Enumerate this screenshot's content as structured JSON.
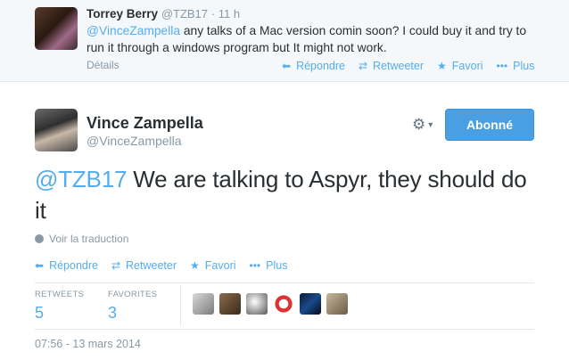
{
  "reply": {
    "name": "Torrey Berry",
    "handle": "@TZB17",
    "time": "· 11 h",
    "mention": "@VinceZampella",
    "text": " any talks of a Mac version comin soon? I could buy it and try to run it through a windows program but It might not work.",
    "details": "Détails",
    "actions": {
      "reply": "Répondre",
      "retweet": "Retweeter",
      "favorite": "Favori",
      "more": "Plus"
    }
  },
  "tweet": {
    "name": "Vince Zampella",
    "handle": "@VinceZampella",
    "follow_label": "Abonné",
    "mention": "@TZB17",
    "text": " We are talking to Aspyr, they should do it",
    "translate": "Voir la traduction",
    "actions": {
      "reply": "Répondre",
      "retweet": "Retweeter",
      "favorite": "Favori",
      "more": "Plus"
    },
    "stats": {
      "retweets_label": "RETWEETS",
      "retweets": "5",
      "favorites_label": "FAVORITES",
      "favorites": "3"
    },
    "timestamp": "07:56 - 13 mars 2014"
  },
  "icons": {
    "reply": "reply-icon",
    "retweet": "retweet-icon",
    "favorite": "star-icon",
    "more": "more-dots-icon",
    "gear": "gear-icon",
    "globe": "globe-icon"
  },
  "colors": {
    "accent": "#55acee",
    "follow_button": "#4a9fe3",
    "muted": "#8899a6",
    "text": "#292f33"
  }
}
